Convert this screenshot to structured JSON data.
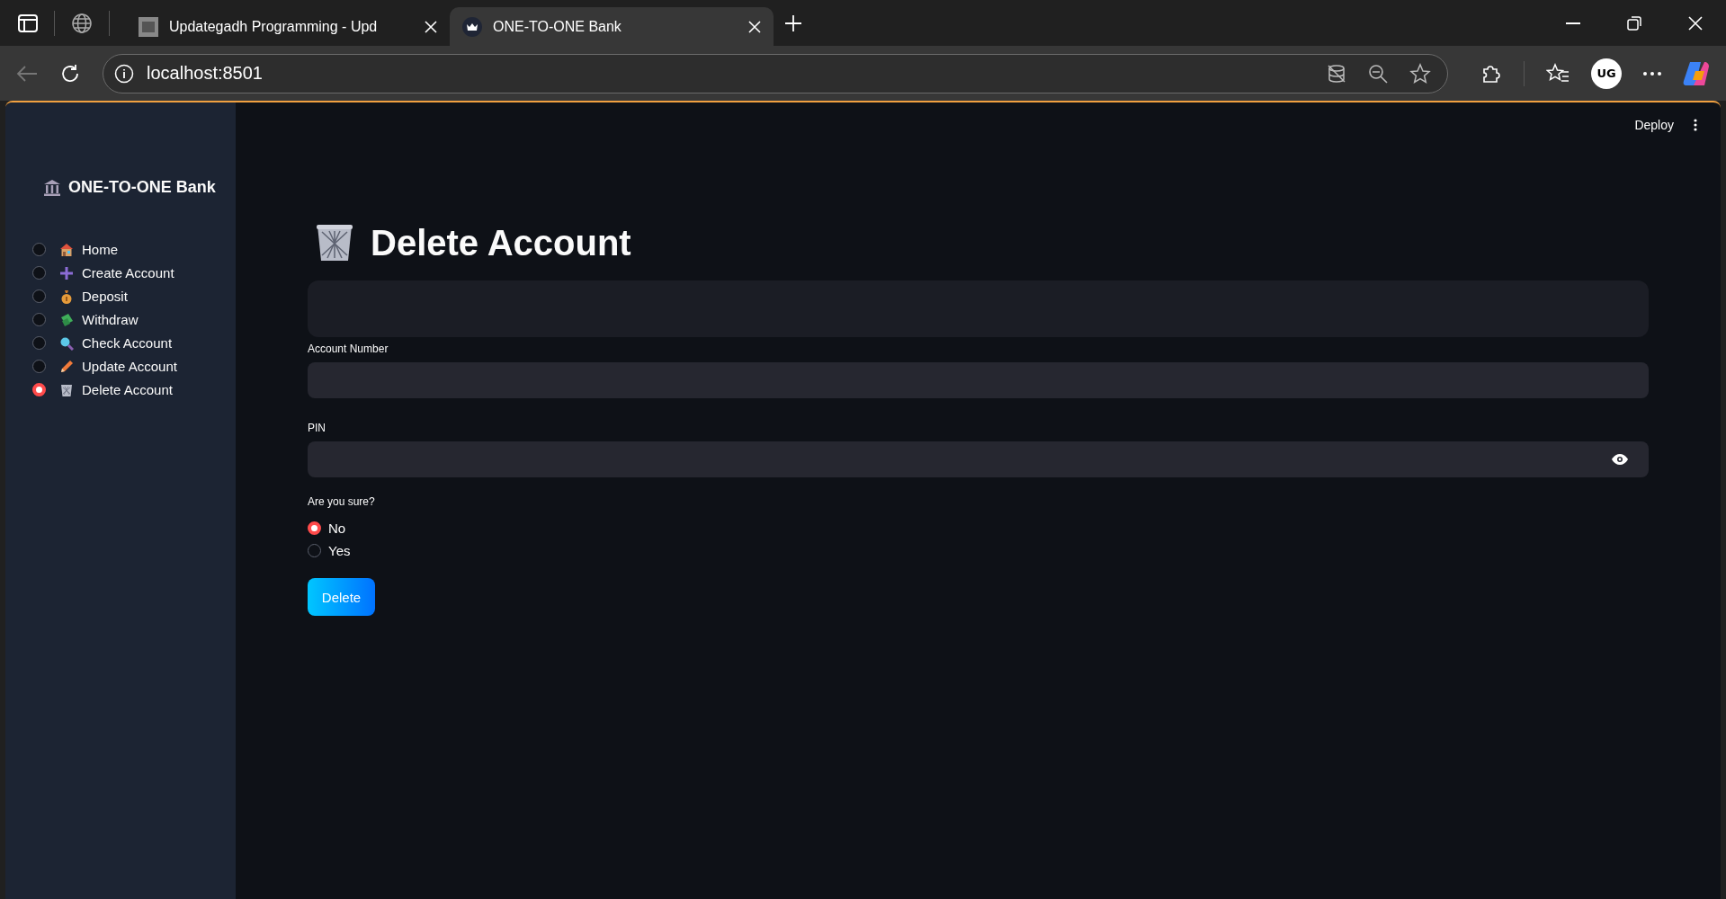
{
  "browser": {
    "tabs": [
      {
        "title": "Updategadh Programming - Upd",
        "selected": false,
        "kind": "ug"
      },
      {
        "title": "ONE-TO-ONE Bank",
        "selected": true,
        "kind": "crown"
      }
    ],
    "address": "localhost:8501",
    "profile_initials": "UG"
  },
  "header": {
    "deploy": "Deploy"
  },
  "sidebar": {
    "title": "ONE-TO-ONE Bank",
    "items": [
      {
        "label": "Home",
        "kind": "house",
        "selected": false
      },
      {
        "label": "Create Account",
        "kind": "plus",
        "selected": false
      },
      {
        "label": "Deposit",
        "kind": "moneybag",
        "selected": false
      },
      {
        "label": "Withdraw",
        "kind": "money",
        "selected": false
      },
      {
        "label": "Check Account",
        "kind": "magnifier",
        "selected": false
      },
      {
        "label": "Update Account",
        "kind": "pencil",
        "selected": false
      },
      {
        "label": "Delete Account",
        "kind": "basket",
        "selected": true
      }
    ]
  },
  "main": {
    "title": "Delete Account",
    "fields": [
      {
        "label": "Account Number",
        "kind": "text"
      },
      {
        "label": "PIN",
        "kind": "password"
      }
    ],
    "confirm": {
      "label": "Are you sure?",
      "options": [
        {
          "label": "No",
          "selected": true
        },
        {
          "label": "Yes",
          "selected": false
        }
      ]
    },
    "button": "Delete"
  }
}
